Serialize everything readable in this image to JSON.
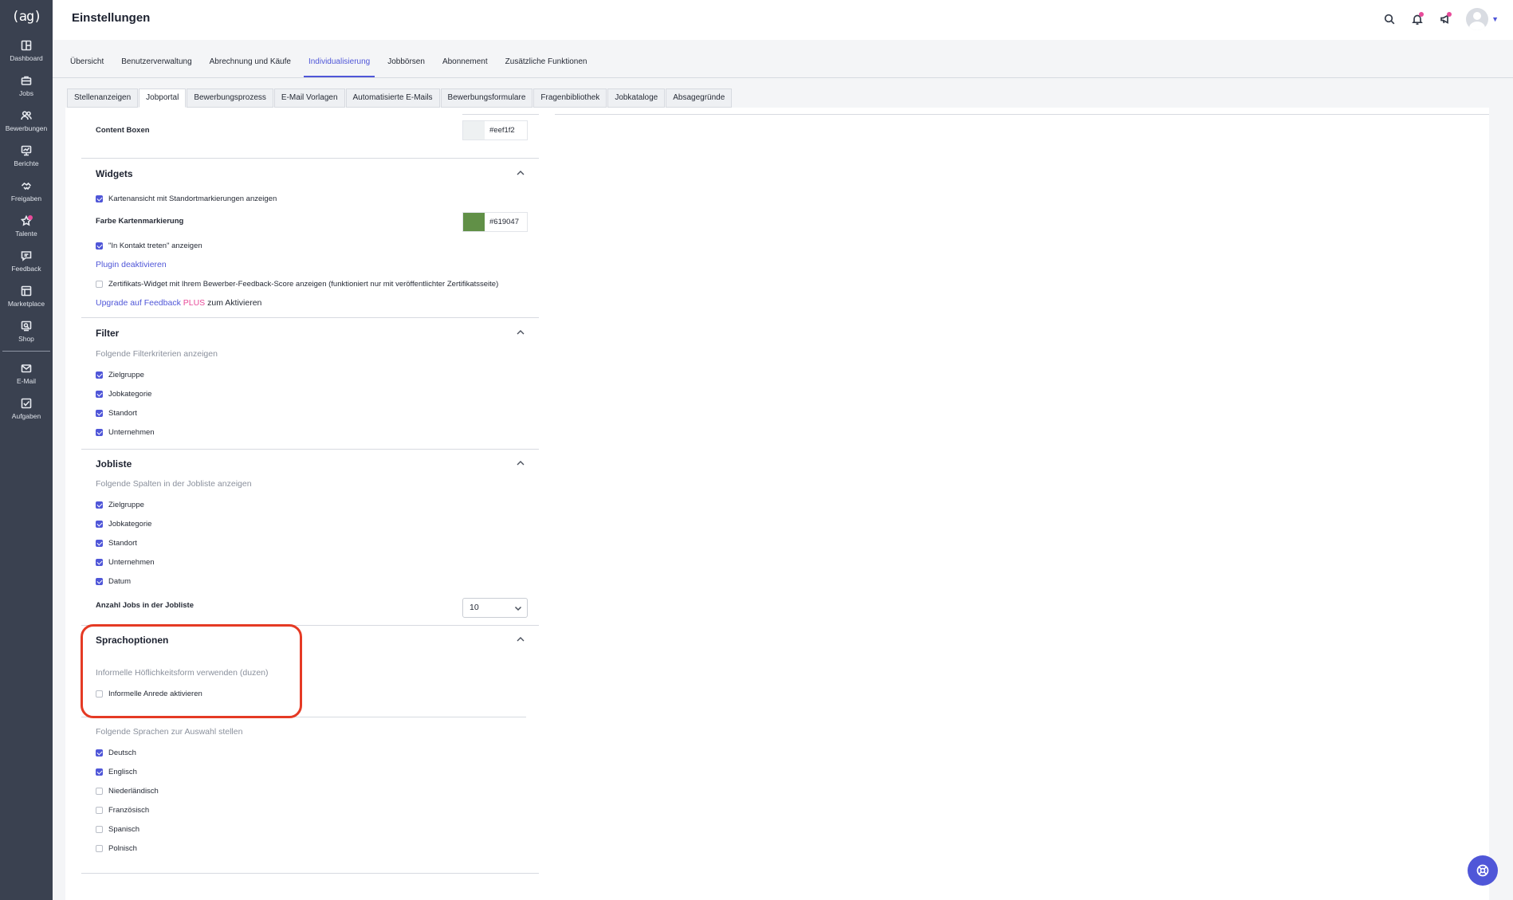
{
  "app": {
    "logo_text": "(ag)",
    "title": "Einstellungen"
  },
  "sidebar": {
    "items": [
      {
        "label": "Dashboard",
        "icon": "dashboard-icon"
      },
      {
        "label": "Jobs",
        "icon": "briefcase-icon"
      },
      {
        "label": "Bewerbungen",
        "icon": "users-icon"
      },
      {
        "label": "Berichte",
        "icon": "report-icon"
      },
      {
        "label": "Freigaben",
        "icon": "handshake-icon"
      },
      {
        "label": "Talente",
        "icon": "star-icon"
      },
      {
        "label": "Feedback",
        "icon": "feedback-icon"
      },
      {
        "label": "Marketplace",
        "icon": "marketplace-icon"
      },
      {
        "label": "Shop",
        "icon": "shop-icon"
      },
      {
        "label": "E-Mail",
        "icon": "mail-icon"
      },
      {
        "label": "Aufgaben",
        "icon": "tasks-icon"
      }
    ]
  },
  "main_tabs": [
    "Übersicht",
    "Benutzerverwaltung",
    "Abrechnung und Käufe",
    "Individualisierung",
    "Jobbörsen",
    "Abonnement",
    "Zusätzliche Funktionen"
  ],
  "main_tab_active": "Individualisierung",
  "sub_tabs": [
    "Stellenanzeigen",
    "Jobportal",
    "Bewerbungsprozess",
    "E-Mail Vorlagen",
    "Automatisierte E-Mails",
    "Bewerbungsformulare",
    "Fragenbibliothek",
    "Jobkataloge",
    "Absagegründe"
  ],
  "sub_tab_active": "Jobportal",
  "content_boxes": {
    "label": "Content Boxen",
    "color": "#eef1f2",
    "hex": "#eef1f2"
  },
  "widgets": {
    "title": "Widgets",
    "map_view": {
      "label": "Kartenansicht mit Standortmarkierungen anzeigen",
      "checked": true
    },
    "marker_color": {
      "label": "Farbe Kartenmarkierung",
      "color": "#619047",
      "hex": "#619047"
    },
    "contact": {
      "label": "\"In Kontakt treten\" anzeigen",
      "checked": true
    },
    "plugin_link": "Plugin deaktivieren",
    "certificate": {
      "label": "Zertifikats-Widget mit Ihrem Bewerber-Feedback-Score anzeigen (funktioniert nur mit veröffentlichter Zertifikatsseite)",
      "checked": false
    },
    "upgrade": {
      "prefix": "Upgrade auf Feedback",
      "plus": "PLUS",
      "suffix": "zum Aktivieren"
    }
  },
  "filter": {
    "title": "Filter",
    "hint": "Folgende Filterkriterien anzeigen",
    "items": [
      {
        "label": "Zielgruppe",
        "checked": true
      },
      {
        "label": "Jobkategorie",
        "checked": true
      },
      {
        "label": "Standort",
        "checked": true
      },
      {
        "label": "Unternehmen",
        "checked": true
      }
    ]
  },
  "jobliste": {
    "title": "Jobliste",
    "hint": "Folgende Spalten in der Jobliste anzeigen",
    "items": [
      {
        "label": "Zielgruppe",
        "checked": true
      },
      {
        "label": "Jobkategorie",
        "checked": true
      },
      {
        "label": "Standort",
        "checked": true
      },
      {
        "label": "Unternehmen",
        "checked": true
      },
      {
        "label": "Datum",
        "checked": true
      }
    ],
    "count_label": "Anzahl Jobs in der Jobliste",
    "count_value": "10"
  },
  "sprachoptionen": {
    "title": "Sprachoptionen",
    "informal_hint": "Informelle Höflichkeitsform verwenden (duzen)",
    "informal": {
      "label": "Informelle Anrede aktivieren",
      "checked": false
    },
    "languages_hint": "Folgende Sprachen zur Auswahl stellen",
    "languages": [
      {
        "label": "Deutsch",
        "checked": true
      },
      {
        "label": "Englisch",
        "checked": true
      },
      {
        "label": "Niederländisch",
        "checked": false
      },
      {
        "label": "Französisch",
        "checked": false
      },
      {
        "label": "Spanisch",
        "checked": false
      },
      {
        "label": "Polnisch",
        "checked": false
      }
    ]
  },
  "colors": {
    "accent": "#4f56d8",
    "sidebar": "#3a4150",
    "badge": "#e84b9a",
    "highlight": "#e53a24"
  }
}
